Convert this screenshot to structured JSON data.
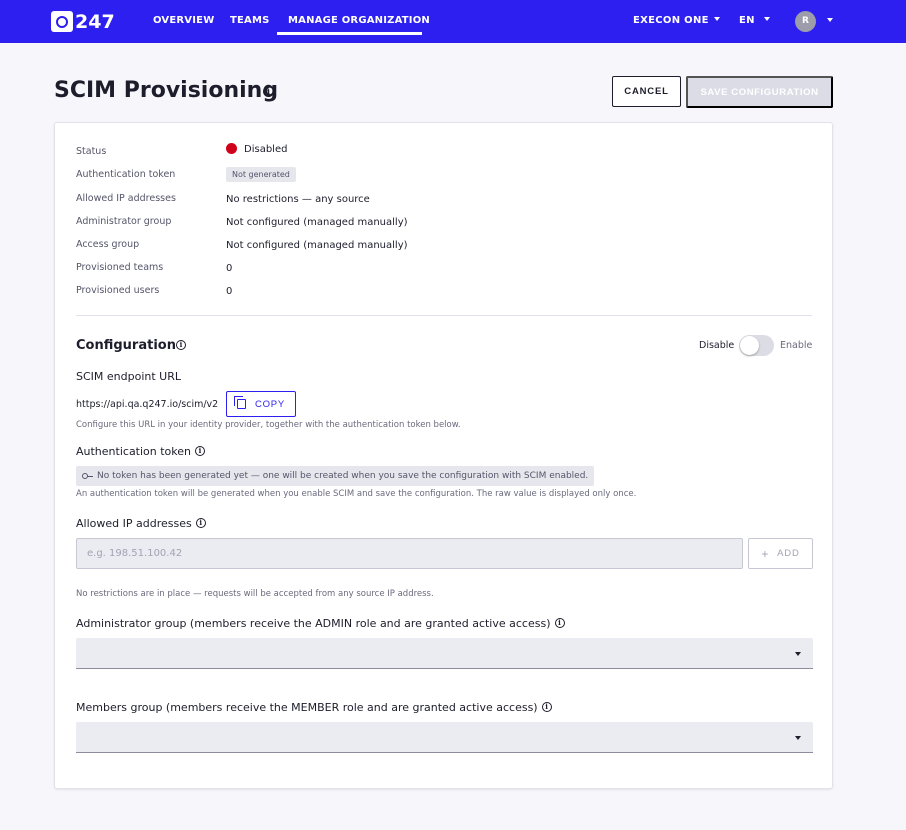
{
  "app": {
    "logo_text": "247"
  },
  "nav": {
    "items": [
      {
        "label": "OVERVIEW"
      },
      {
        "label": "TEAMS"
      },
      {
        "label": "MANAGE ORGANIZATION",
        "active": true
      }
    ],
    "org": "EXECON ONE",
    "lang": "EN",
    "avatar_initial": "R"
  },
  "header": {
    "title": "SCIM Provisioning",
    "cancel_label": "CANCEL",
    "save_label": "SAVE CONFIGURATION"
  },
  "status": {
    "rows": [
      {
        "label": "Status",
        "value": "Disabled"
      },
      {
        "label": "Authentication token",
        "value": "Not generated"
      },
      {
        "label": "Allowed IP addresses",
        "value": "No restrictions — any source"
      },
      {
        "label": "Administrator group",
        "value": "Not configured (managed manually)"
      },
      {
        "label": "Access group",
        "value": "Not configured (managed manually)"
      },
      {
        "label": "Provisioned teams",
        "value": "0"
      },
      {
        "label": "Provisioned users",
        "value": "0"
      }
    ],
    "status_color": "#d0021b"
  },
  "config": {
    "title": "Configuration",
    "toggle_off_label": "Disable",
    "toggle_on_label": "Enable",
    "toggle_enabled": false,
    "endpoint_label": "SCIM endpoint URL",
    "endpoint_url": "https://api.qa.q247.io/scim/v2",
    "copy_label": "COPY",
    "endpoint_helper": "Configure this URL in your identity provider, together with the authentication token below.",
    "token_label": "Authentication token",
    "token_notice": "No token has been generated yet — one will be created when you save the configuration with SCIM enabled.",
    "token_helper": "An authentication token will be generated when you enable SCIM and save the configuration. The raw value is displayed only once.",
    "ip_label": "Allowed IP addresses",
    "ip_placeholder": "e.g. 198.51.100.42",
    "add_label": "ADD",
    "ip_helper": "No restrictions are in place — requests will be accepted from any source IP address.",
    "admin_group_label": "Administrator group (members receive the ADMIN role and are granted active access)",
    "members_group_label": "Members group (members receive the MEMBER role and are granted active access)"
  },
  "colors": {
    "brand": "#2c1ff0"
  }
}
